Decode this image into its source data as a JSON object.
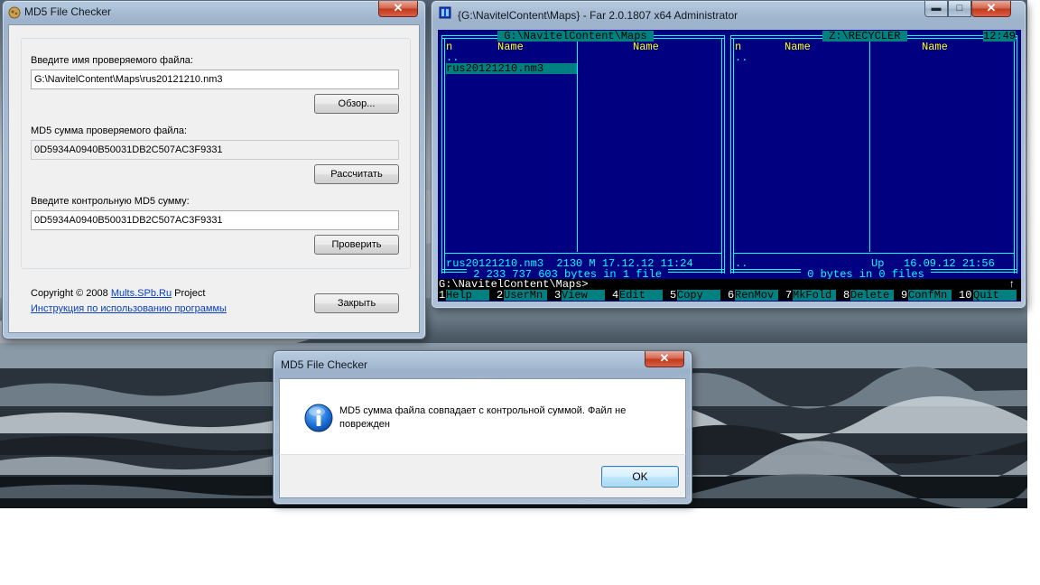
{
  "md5_window": {
    "title": "MD5 File Checker",
    "close_label": "✕",
    "file_label": "Введите имя проверяемого файла:",
    "file_value": "G:\\NavitelContent\\Maps\\rus20121210.nm3",
    "browse_label": "Обзор...",
    "md5_label": "MD5 сумма проверяемого файла:",
    "md5_value": "0D5934A0940B50031DB2C507AC3F9331",
    "calc_label": "Рассчитать",
    "control_label": "Введите контрольную MD5 сумму:",
    "control_value": "0D5934A0940B50031DB2C507AC3F9331",
    "verify_label": "Проверить",
    "copyright_prefix": "Copyright © 2008 ",
    "copyright_link": "Mults.SPb.Ru",
    "copyright_suffix": " Project",
    "instructions_link": "Инструкция по использованию программы",
    "close_button_label": "Закрыть"
  },
  "far_window": {
    "title": "{G:\\NavitelContent\\Maps} - Far 2.0.1807 x64 Administrator",
    "minimize_label": "▬",
    "maximize_label": "□",
    "close_label": "✕",
    "left_panel": {
      "path": " G:\\NavitelContent\\Maps ",
      "col_n": "n",
      "col_name1": "Name",
      "col_name2": "Name",
      "updir": "..",
      "file_selected": "rus20121210.nm3",
      "info": "rus20121210.nm3  2130 M 17.12.12 11:24",
      "summary": " 2 233 737 603 bytes in 1 file "
    },
    "right_panel": {
      "path": " Z:\\RECYCLER ",
      "clock": "12:49",
      "col_n": "n",
      "col_name1": "Name",
      "col_name2": "Name",
      "updir": "..",
      "info_left": "..",
      "info_right": "Up   16.09.12 21:56",
      "summary": " 0 bytes in 0 files "
    },
    "prompt": "G:\\NavitelContent\\Maps>",
    "scroll_arrow": "↑",
    "keybar": [
      {
        "num": "1",
        "label": "Help  "
      },
      {
        "num": "2",
        "label": "UserMn"
      },
      {
        "num": "3",
        "label": "View  "
      },
      {
        "num": "4",
        "label": "Edit  "
      },
      {
        "num": "5",
        "label": "Copy  "
      },
      {
        "num": "6",
        "label": "RenMov"
      },
      {
        "num": "7",
        "label": "MkFold"
      },
      {
        "num": "8",
        "label": "Delete"
      },
      {
        "num": "9",
        "label": "ConfMn"
      },
      {
        "num": "10",
        "label": "Quit  "
      }
    ]
  },
  "dialog": {
    "title": "MD5 File Checker",
    "close_label": "✕",
    "message": "MD5 сумма файла совпадает с контрольной суммой. Файл не поврежден",
    "icon": "info-icon",
    "ok_label": "OK"
  }
}
